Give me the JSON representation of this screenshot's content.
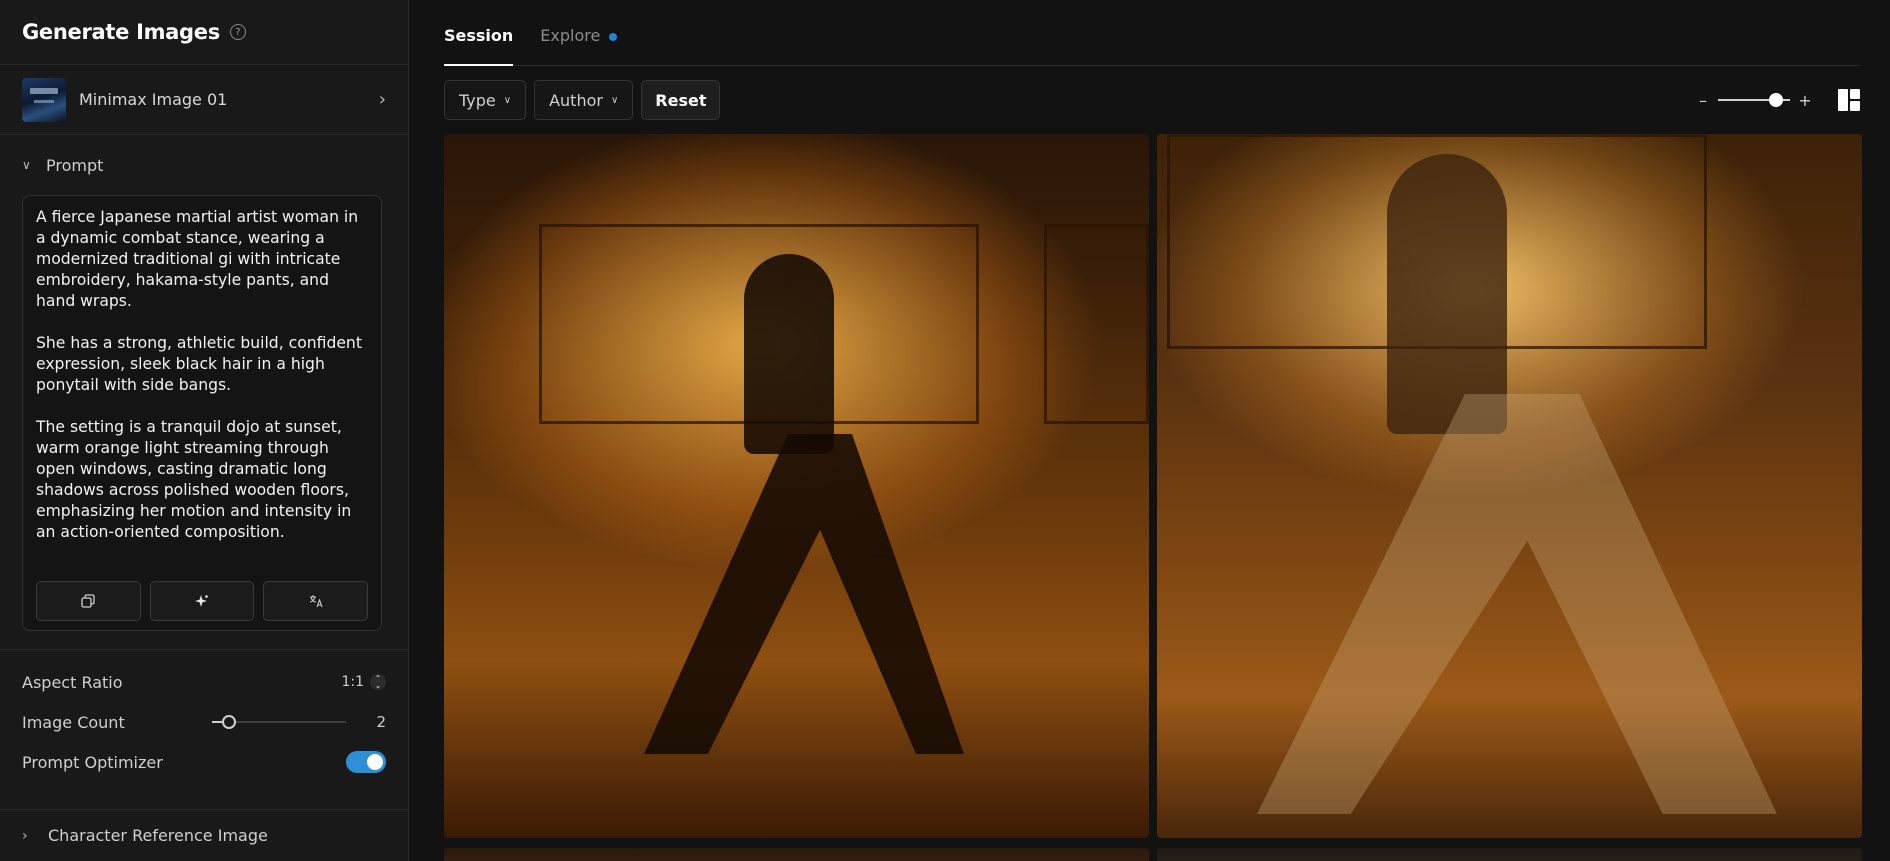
{
  "sidebar": {
    "title": "Generate Images",
    "model_name": "Minimax Image 01",
    "prompt_label": "Prompt",
    "prompt_text": "A fierce Japanese martial artist woman in a dynamic combat stance, wearing a modernized traditional gi with intricate embroidery, hakama-style pants, and hand wraps.\n\nShe has a strong, athletic build, confident expression, sleek black hair in a high ponytail with side bangs.\n\nThe setting is a tranquil dojo at sunset, warm orange light streaming through open windows, casting dramatic long shadows across polished wooden floors, emphasizing her motion and intensity in an action-oriented composition.",
    "prompt_actions": [
      "copy-icon",
      "sparkle-icon",
      "translate-icon"
    ],
    "aspect_ratio_label": "Aspect Ratio",
    "aspect_ratio_value": "1:1",
    "image_count_label": "Image Count",
    "image_count_value": "2",
    "image_count_fraction": 0.13,
    "prompt_optimizer_label": "Prompt Optimizer",
    "prompt_optimizer_on": true,
    "character_reference_label": "Character Reference Image"
  },
  "tabs": [
    {
      "label": "Session",
      "active": true
    },
    {
      "label": "Explore",
      "active": false,
      "has_dot": true
    }
  ],
  "toolbar": {
    "type_label": "Type",
    "author_label": "Author",
    "reset_label": "Reset",
    "zoom_fraction": 0.8
  },
  "colors": {
    "accent": "#2d8fd5",
    "dot": "#1f88d6",
    "background": "#121212",
    "sidebar": "#191919"
  }
}
